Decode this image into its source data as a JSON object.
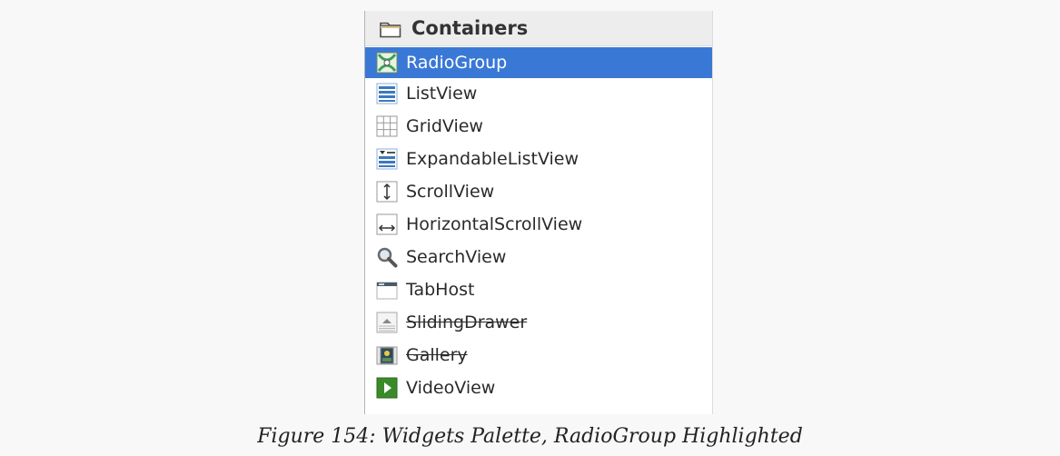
{
  "palette": {
    "category": "Containers",
    "items": [
      {
        "label": "RadioGroup",
        "icon": "radiogroup-icon",
        "selected": true,
        "deprecated": false
      },
      {
        "label": "ListView",
        "icon": "listview-icon",
        "selected": false,
        "deprecated": false
      },
      {
        "label": "GridView",
        "icon": "gridview-icon",
        "selected": false,
        "deprecated": false
      },
      {
        "label": "ExpandableListView",
        "icon": "expandablelistview-icon",
        "selected": false,
        "deprecated": false
      },
      {
        "label": "ScrollView",
        "icon": "scrollview-icon",
        "selected": false,
        "deprecated": false
      },
      {
        "label": "HorizontalScrollView",
        "icon": "horizontalscrollview-icon",
        "selected": false,
        "deprecated": false
      },
      {
        "label": "SearchView",
        "icon": "searchview-icon",
        "selected": false,
        "deprecated": false
      },
      {
        "label": "TabHost",
        "icon": "tabhost-icon",
        "selected": false,
        "deprecated": false
      },
      {
        "label": "SlidingDrawer",
        "icon": "slidingdrawer-icon",
        "selected": false,
        "deprecated": true
      },
      {
        "label": "Gallery",
        "icon": "gallery-icon",
        "selected": false,
        "deprecated": true
      },
      {
        "label": "VideoView",
        "icon": "videoview-icon",
        "selected": false,
        "deprecated": false
      }
    ]
  },
  "caption": "Figure 154: Widgets Palette, RadioGroup Highlighted",
  "colors": {
    "selection": "#3a78d6",
    "folder": "#d9c08a"
  }
}
